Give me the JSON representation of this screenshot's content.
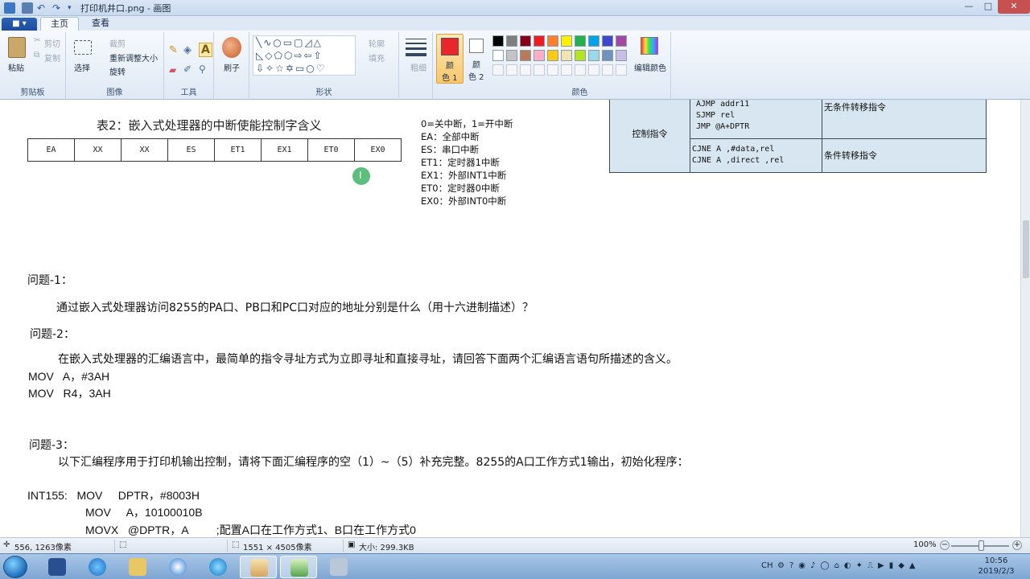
{
  "window": {
    "title": "打印机井口.png - 画图",
    "controls": [
      "—",
      "□",
      "✕"
    ]
  },
  "ribbon": {
    "app_menu": "■ ▾",
    "tabs": [
      "主页",
      "查看"
    ],
    "clipboard": {
      "paste": "粘贴",
      "cut": "剪切",
      "copy": "复制",
      "label": "剪贴板"
    },
    "image": {
      "select": "选择",
      "crop": "裁剪",
      "resize": "重新调整大小",
      "rotate": "旋转",
      "label": "图像"
    },
    "tools": {
      "label": "工具"
    },
    "brushes": {
      "label": "刷子"
    },
    "shapes": {
      "outline": "轮廓",
      "fill": "填充",
      "label": "形状"
    },
    "size": {
      "label": "粗细"
    },
    "color1": {
      "line1": "颜",
      "line2": "色 1"
    },
    "color2": {
      "line1": "颜",
      "line2": "色 2"
    },
    "colors": {
      "label": "颜色",
      "edit": "编辑颜色",
      "color1_value": "#e8262b",
      "color2_value": "#ffffff",
      "row1": [
        "#000000",
        "#7f7f7f",
        "#880015",
        "#ed1c24",
        "#ff7f27",
        "#fff200",
        "#22b14c",
        "#00a2e8",
        "#3f48cc",
        "#a349a4"
      ],
      "row2": [
        "#ffffff",
        "#c3c3c3",
        "#b97a57",
        "#ffaec9",
        "#ffc90e",
        "#efe4b0",
        "#b5e61d",
        "#99d9ea",
        "#7092be",
        "#c8bfe7"
      ]
    }
  },
  "document": {
    "table_title": "表2：嵌入式处理器的中断使能控制字含义",
    "bits": [
      "EA",
      "XX",
      "XX",
      "ES",
      "ET1",
      "EX1",
      "ET0",
      "EX0"
    ],
    "legend": [
      "0=关中断，1=开中断",
      "EA：全部中断",
      "ES：串口中断",
      "ET1：定时器1中断",
      "EX1：外部INT1中断",
      "ET0：定时器0中断",
      "EX0：外部INT0中断"
    ],
    "instr_table": {
      "category": "控制指令",
      "row1_code": [
        "AJMP    addr11",
        "SJMP   rel",
        "JMP    @A+DPTR"
      ],
      "row1_desc": "无条件转移指令",
      "row2_code": [
        "CJNE  A ,#data,rel",
        "CJNE  A ,direct ,rel"
      ],
      "row2_desc": "条件转移指令"
    },
    "q1_title": "问题-1：",
    "q1_text": "通过嵌入式处理器访问8255的PA口、PB口和PC口对应的地址分别是什么（用十六进制描述）？",
    "q2_title": "问题-2：",
    "q2_text": "在嵌入式处理器的汇编语言中，最简单的指令寻址方式为立即寻址和直接寻址，请回答下面两个汇编语言语句所描述的含义。",
    "q2_code1": "MOV   A，#3AH",
    "q2_code2": "MOV   R4，3AH",
    "q3_title": "问题-3：",
    "q3_text": "以下汇编程序用于打印机输出控制，请将下面汇编程序的空（1）~（5）补充完整。8255的A口工作方式1输出，初始化程序：",
    "code_line1": "INT155:   MOV     DPTR，#8003H",
    "code_line2": "MOV     A，10100010B",
    "code_line3": "MOVX   @DPTR，A         ;配置A口在工作方式1、B口在工作方式0"
  },
  "status": {
    "cursor_pos": "556, 1263像素",
    "dimensions": "1551 × 4505像素",
    "file_size": "大小: 299.3KB",
    "zoom": "100%",
    "zoom_out": "−",
    "zoom_in": "+",
    "zoom_level": 1.0
  },
  "taskbar": {
    "tray_lang": "CH",
    "time": "10:56",
    "date": "2019/2/3"
  }
}
